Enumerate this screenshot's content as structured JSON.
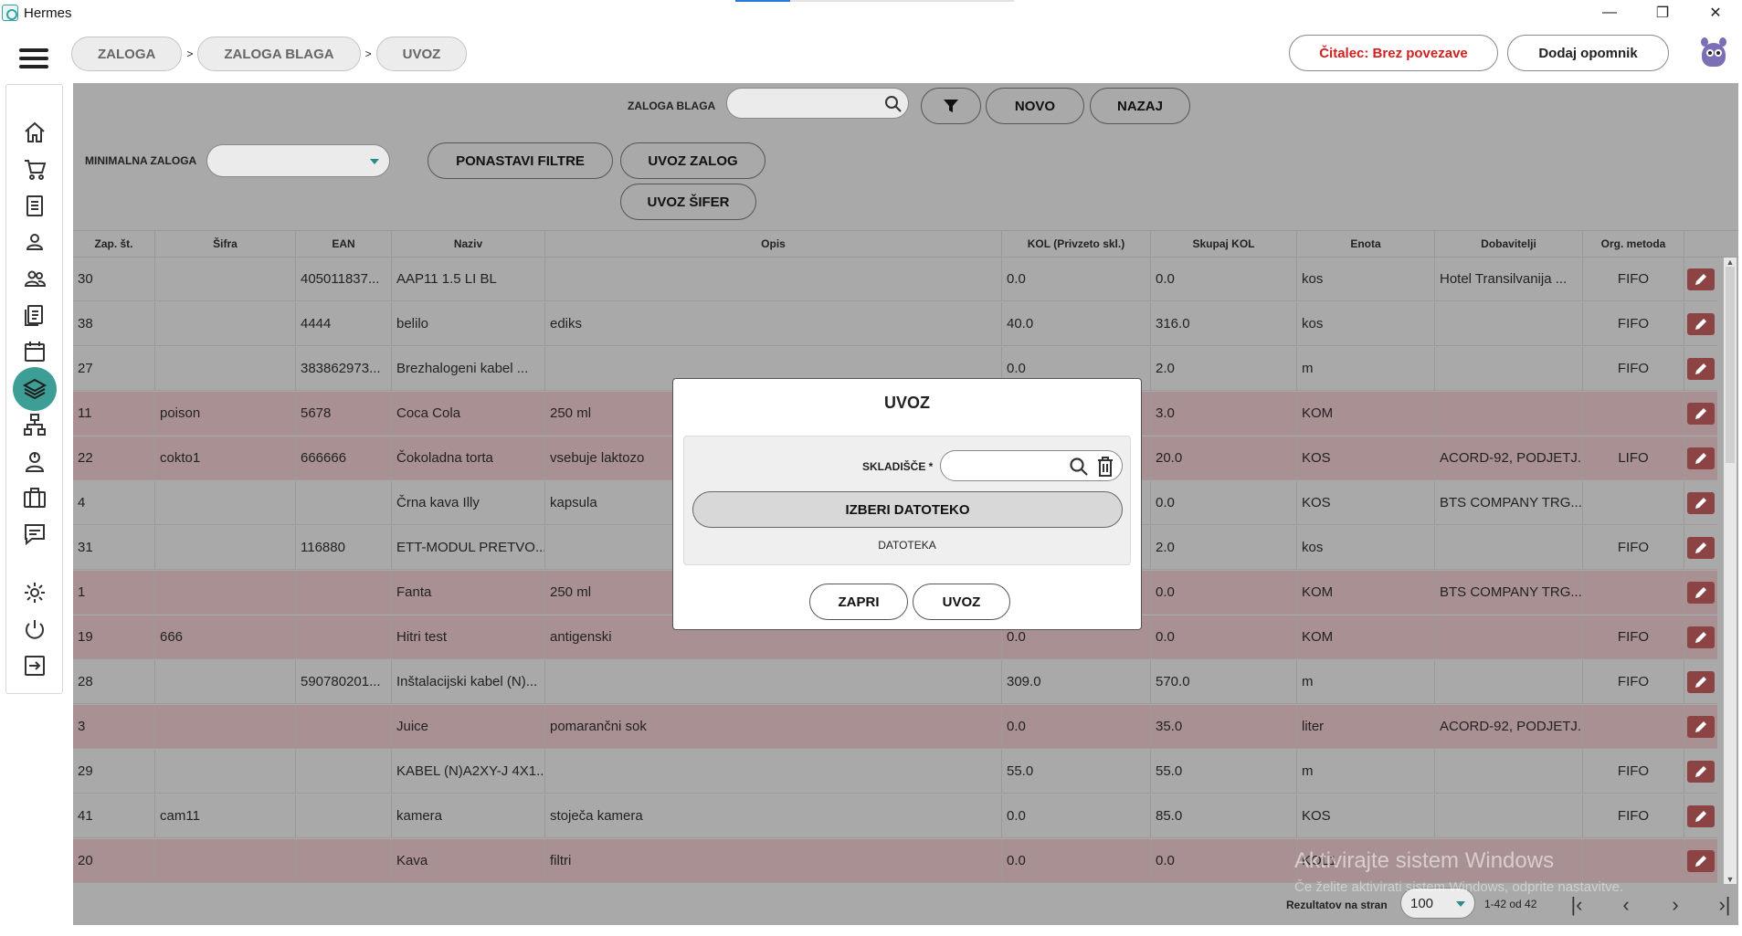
{
  "window": {
    "title": "Hermes",
    "controls": [
      "—",
      "❐",
      "✕"
    ]
  },
  "breadcrumb": [
    "ZALOGA",
    "ZALOGA BLAGA",
    "UVOZ"
  ],
  "breadcrumb_sep": ">",
  "header": {
    "reader_status": "Čitalec: Brez povezave",
    "add_reminder": "Dodaj opomnik"
  },
  "sidebar": {
    "items": [
      "home-icon",
      "cart-icon",
      "document-icon",
      "user-icon",
      "users-icon",
      "list-icon",
      "calendar-icon",
      "layers-icon",
      "network-icon",
      "support-icon",
      "briefcase-icon",
      "chat-icon",
      "gear-icon",
      "power-icon",
      "logout-icon"
    ],
    "active_index": 7
  },
  "filters": {
    "search_label": "ZALOGA BLAGA",
    "search_value": "",
    "novo": "NOVO",
    "nazaj": "NAZAJ",
    "min_stock_label": "MINIMALNA ZALOGA",
    "min_stock_value": "",
    "reset_filters": "PONASTAVI FILTRE",
    "import_stock": "UVOZ ZALOG",
    "import_codes": "UVOZ ŠIFER"
  },
  "table": {
    "columns": [
      "Zap. št.",
      "Šifra",
      "EAN",
      "Naziv",
      "Opis",
      "KOL (Privzeto skl.)",
      "Skupaj KOL",
      "Enota",
      "Dobavitelji",
      "Org. metoda",
      ""
    ],
    "rows": [
      {
        "zap": "30",
        "sifra": "",
        "ean": "405011837...",
        "naziv": "AAP11 1.5 LI BL",
        "opis": "",
        "kol": "0.0",
        "skupaj": "0.0",
        "enota": "kos",
        "dob": "Hotel Transilvanija ...",
        "metoda": "FIFO",
        "tone": "plain"
      },
      {
        "zap": "38",
        "sifra": "",
        "ean": "4444",
        "naziv": "belilo",
        "opis": "ediks",
        "kol": "40.0",
        "skupaj": "316.0",
        "enota": "kos",
        "dob": "",
        "metoda": "FIFO",
        "tone": "plain"
      },
      {
        "zap": "27",
        "sifra": "",
        "ean": "383862973...",
        "naziv": "Brezhalogeni kabel ...",
        "opis": "",
        "kol": "0.0",
        "skupaj": "2.0",
        "enota": "m",
        "dob": "",
        "metoda": "FIFO",
        "tone": "plain"
      },
      {
        "zap": "11",
        "sifra": "poison",
        "ean": "5678",
        "naziv": "Coca Cola",
        "opis": "250 ml",
        "kol": "",
        "skupaj": "3.0",
        "enota": "KOM",
        "dob": "",
        "metoda": "",
        "tone": "pink"
      },
      {
        "zap": "22",
        "sifra": "cokto1",
        "ean": "666666",
        "naziv": "Čokoladna torta",
        "opis": "vsebuje laktozo",
        "kol": "",
        "skupaj": "20.0",
        "enota": "KOS",
        "dob": "ACORD-92, PODJETJ...",
        "metoda": "LIFO",
        "tone": "pink"
      },
      {
        "zap": "4",
        "sifra": "",
        "ean": "",
        "naziv": "Črna kava Illy",
        "opis": "kapsula",
        "kol": "",
        "skupaj": "0.0",
        "enota": "KOS",
        "dob": "BTS COMPANY TRG...",
        "metoda": "",
        "tone": "plain"
      },
      {
        "zap": "31",
        "sifra": "",
        "ean": "116880",
        "naziv": "ETT-MODUL PRETVO...",
        "opis": "",
        "kol": "",
        "skupaj": "2.0",
        "enota": "kos",
        "dob": "",
        "metoda": "FIFO",
        "tone": "plain"
      },
      {
        "zap": "1",
        "sifra": "",
        "ean": "",
        "naziv": "Fanta",
        "opis": "250 ml",
        "kol": "",
        "skupaj": "0.0",
        "enota": "KOM",
        "dob": "BTS COMPANY TRG...",
        "metoda": "",
        "tone": "pink"
      },
      {
        "zap": "19",
        "sifra": "666",
        "ean": "",
        "naziv": "Hitri test",
        "opis": "antigenski",
        "kol": "0.0",
        "skupaj": "0.0",
        "enota": "KOM",
        "dob": "",
        "metoda": "FIFO",
        "tone": "pink"
      },
      {
        "zap": "28",
        "sifra": "",
        "ean": "590780201...",
        "naziv": "Inštalacijski kabel (N)...",
        "opis": "",
        "kol": "309.0",
        "skupaj": "570.0",
        "enota": "m",
        "dob": "",
        "metoda": "FIFO",
        "tone": "plain"
      },
      {
        "zap": "3",
        "sifra": "",
        "ean": "",
        "naziv": "Juice",
        "opis": "pomarančni sok",
        "kol": "0.0",
        "skupaj": "35.0",
        "enota": "liter",
        "dob": "ACORD-92, PODJETJ...",
        "metoda": "",
        "tone": "pink"
      },
      {
        "zap": "29",
        "sifra": "",
        "ean": "",
        "naziv": "KABEL (N)A2XY-J 4X1...",
        "opis": "",
        "kol": "55.0",
        "skupaj": "55.0",
        "enota": "m",
        "dob": "",
        "metoda": "FIFO",
        "tone": "plain"
      },
      {
        "zap": "41",
        "sifra": "cam11",
        "ean": "",
        "naziv": "kamera",
        "opis": "stoječa kamera",
        "kol": "0.0",
        "skupaj": "85.0",
        "enota": "KOS",
        "dob": "",
        "metoda": "FIFO",
        "tone": "plain"
      },
      {
        "zap": "20",
        "sifra": "",
        "ean": "",
        "naziv": "Kava",
        "opis": "filtri",
        "kol": "0.0",
        "skupaj": "0.0",
        "enota": "KOL1",
        "dob": "",
        "metoda": "",
        "tone": "pink"
      }
    ]
  },
  "pagination": {
    "label": "Rezultatov na stran",
    "per_page": "100",
    "range": "1-42 od 42"
  },
  "watermark": {
    "line1": "Aktivirajte sistem Windows",
    "line2": "Če želite aktivirati sistem Windows, odprite nastavitve."
  },
  "modal": {
    "title": "UVOZ",
    "warehouse_label": "SKLADIŠČE *",
    "warehouse_value": "",
    "choose_file": "IZBERI DATOTEKO",
    "file_label": "DATOTEKA",
    "close": "ZAPRI",
    "import": "UVOZ"
  },
  "colors": {
    "accent": "#3d9e95",
    "reader_status": "#d41f1f",
    "edit_button": "#8b4343",
    "row_highlight": "#a99092",
    "panel": "#a9a9a9"
  }
}
